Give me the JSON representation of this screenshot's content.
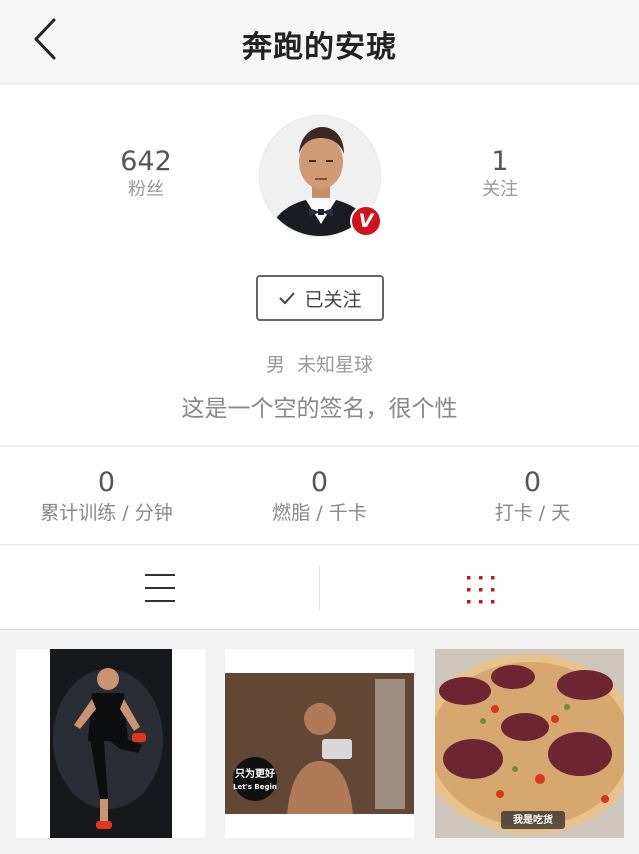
{
  "header": {
    "title": "奔跑的安琥"
  },
  "profile": {
    "fans_count": "642",
    "fans_label": "粉丝",
    "follow_count": "1",
    "follow_label": "关注",
    "verified_badge": "V",
    "follow_button_label": "已关注",
    "gender": "男",
    "location": "未知星球",
    "signature": "这是一个空的签名，很个性"
  },
  "stats": [
    {
      "value": "0",
      "label": "累计训练 / 分钟"
    },
    {
      "value": "0",
      "label": "燃脂 / 千卡"
    },
    {
      "value": "0",
      "label": "打卡 / 天"
    }
  ],
  "tabs": {
    "list_icon": "list-icon",
    "grid_icon": "grid-icon",
    "active": "grid"
  },
  "photos": {
    "p2_tag_line1": "只为更好",
    "p2_tag_line2": "Let's Begin",
    "p3_tag": "我是吃货"
  },
  "colors": {
    "accent_red": "#d0121b",
    "text_gray": "#999999"
  }
}
